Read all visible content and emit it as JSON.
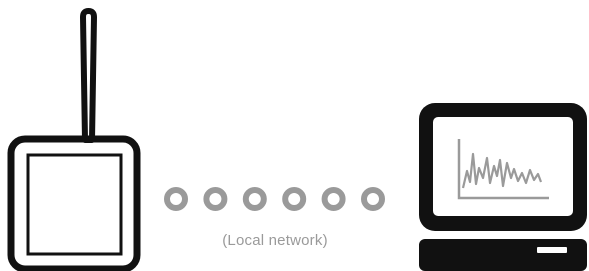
{
  "network": {
    "caption": "(Local network)",
    "dot_count": 6
  },
  "colors": {
    "outline": "#111111",
    "screen_fill": "#ffffff",
    "dots": "#9a9a9a",
    "waveform": "#9a9a9a",
    "caption": "#9a9a9a"
  },
  "icons": {
    "gateway": "wireless-gateway-icon",
    "antenna": "antenna-icon",
    "computer": "computer-monitor-icon",
    "chart": "waveform-chart-icon",
    "network": "network-dots-icon"
  }
}
